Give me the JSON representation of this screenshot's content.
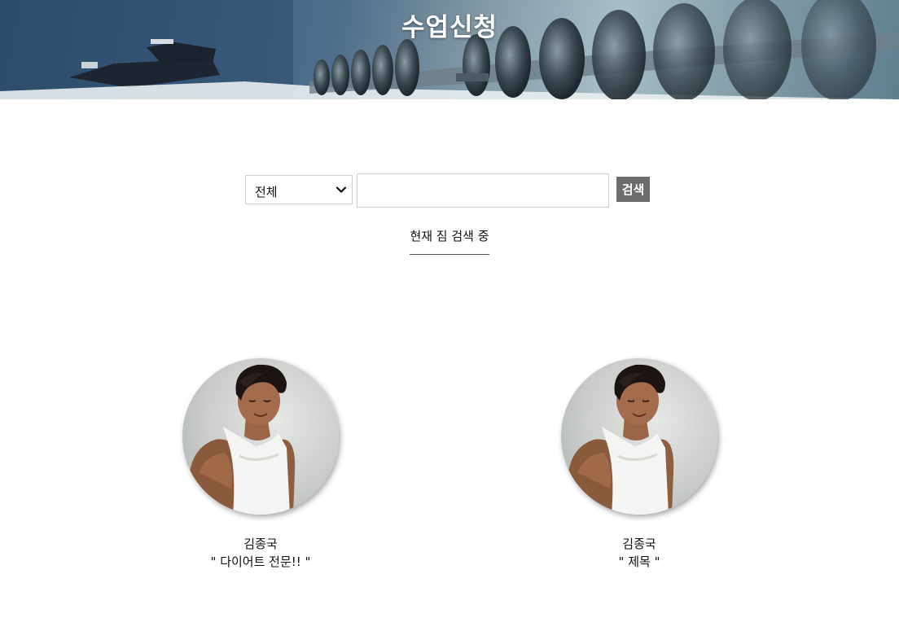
{
  "banner": {
    "title": "수업신청"
  },
  "search": {
    "filter_selected": "전체",
    "input_value": "",
    "button_label": "검색",
    "status_text": "현재 짐 검색 중"
  },
  "trainers": [
    {
      "name": "김종국",
      "description": "\" 다이어트 전문!! \""
    },
    {
      "name": "김종국",
      "description": "\" 제목 \""
    }
  ],
  "colors": {
    "search_button_bg": "#6c6c6c",
    "banner_text": "#ffffff"
  }
}
